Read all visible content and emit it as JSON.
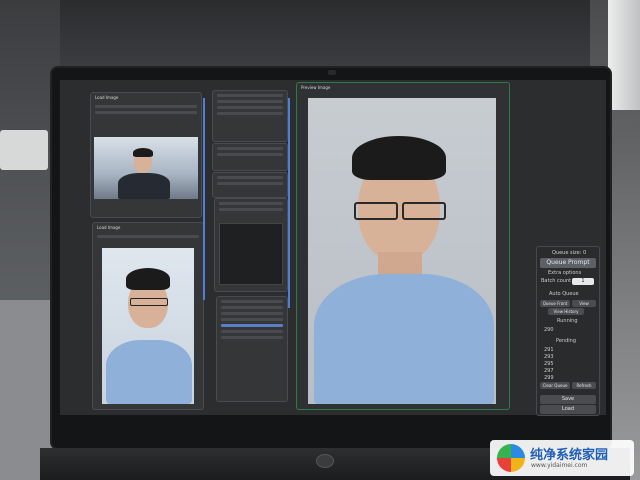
{
  "photo": {
    "description_free": true
  },
  "screen": {
    "left_panel_title": "Load Image",
    "mid_panel_title": "Load Image",
    "preview_title": "Preview Image",
    "sidebar": {
      "queue_size": "Queue size: 0",
      "queue_prompt": "Queue Prompt",
      "extra_options": "Extra options",
      "batch_count": "Batch count",
      "batch_value": "1",
      "auto_queue": "Auto Queue",
      "queue_front": "Queue Front",
      "view_queue": "View",
      "view_history": "View History",
      "running": "Running",
      "running_item": "290",
      "pending": "Pending",
      "pending_items": [
        "291",
        "293",
        "295",
        "297",
        "299"
      ],
      "clear_queue": "Clear Queue",
      "refresh": "Refresh",
      "save": "Save",
      "load": "Load"
    }
  },
  "watermark": {
    "title": "纯净系统家园",
    "url": "www.yidaimei.com"
  },
  "colors": {
    "accent": "#4f7fd9",
    "preview_border": "#2f7a4b",
    "screen_bg": "#2c2d2f"
  }
}
